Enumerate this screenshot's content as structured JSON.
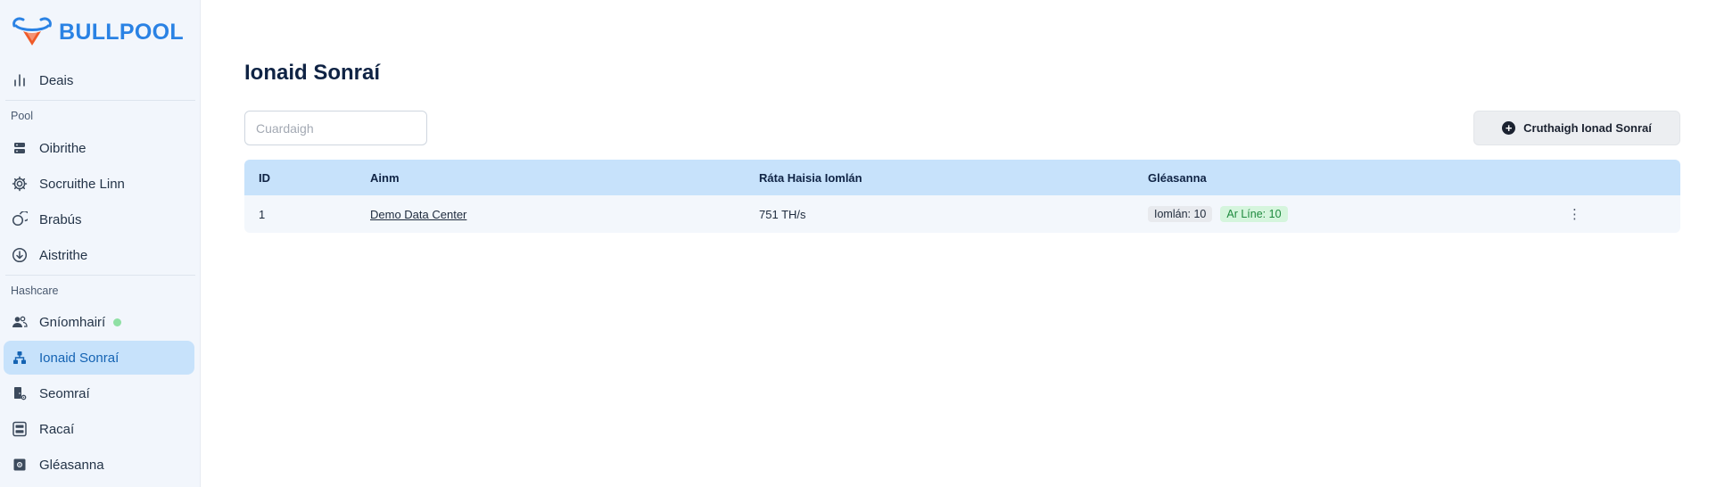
{
  "brand": {
    "name": "BULLPOOL"
  },
  "sidebar": {
    "dashboard": {
      "label": "Deais",
      "icon": "bar-chart-icon"
    },
    "sections": [
      {
        "label": "Pool"
      },
      {
        "label": "Hashcare"
      }
    ],
    "pool_items": [
      {
        "label": "Oibrithe",
        "icon": "server-icon"
      },
      {
        "label": "Socruithe Linn",
        "icon": "gear-icon"
      },
      {
        "label": "Brabús",
        "icon": "coins-icon"
      },
      {
        "label": "Aistrithe",
        "icon": "download-circle-icon"
      }
    ],
    "hashcare_items": [
      {
        "label": "Gníomhairí",
        "icon": "users-icon",
        "status_color": "#8fe0a4"
      },
      {
        "label": "Ionaid Sonraí",
        "icon": "network-icon",
        "active": true
      },
      {
        "label": "Seomraí",
        "icon": "door-gear-icon"
      },
      {
        "label": "Racaí",
        "icon": "rack-icon"
      },
      {
        "label": "Gléasanna",
        "icon": "device-chip-icon"
      }
    ]
  },
  "main": {
    "title": "Ionaid Sonraí",
    "search": {
      "placeholder": "Cuardaigh",
      "value": ""
    },
    "create_button": {
      "label": "Cruthaigh Ionad Sonraí",
      "icon": "plus-circle-icon"
    },
    "table": {
      "columns": [
        "ID",
        "Ainm",
        "Ráta Haisia Iomlán",
        "Gléasanna"
      ],
      "rows": [
        {
          "id": "1",
          "name": "Demo Data Center",
          "hashrate": "751 TH/s",
          "devices_total": "Iomlán: 10",
          "devices_online": "Ar Líne: 10",
          "menu_icon": "kebab-menu-icon"
        }
      ]
    }
  },
  "colors": {
    "accent": "#2a82e4",
    "active_bg": "#c7e2fb",
    "online_badge_bg": "#d5f5dd",
    "online_badge_text": "#1e8a3e"
  }
}
